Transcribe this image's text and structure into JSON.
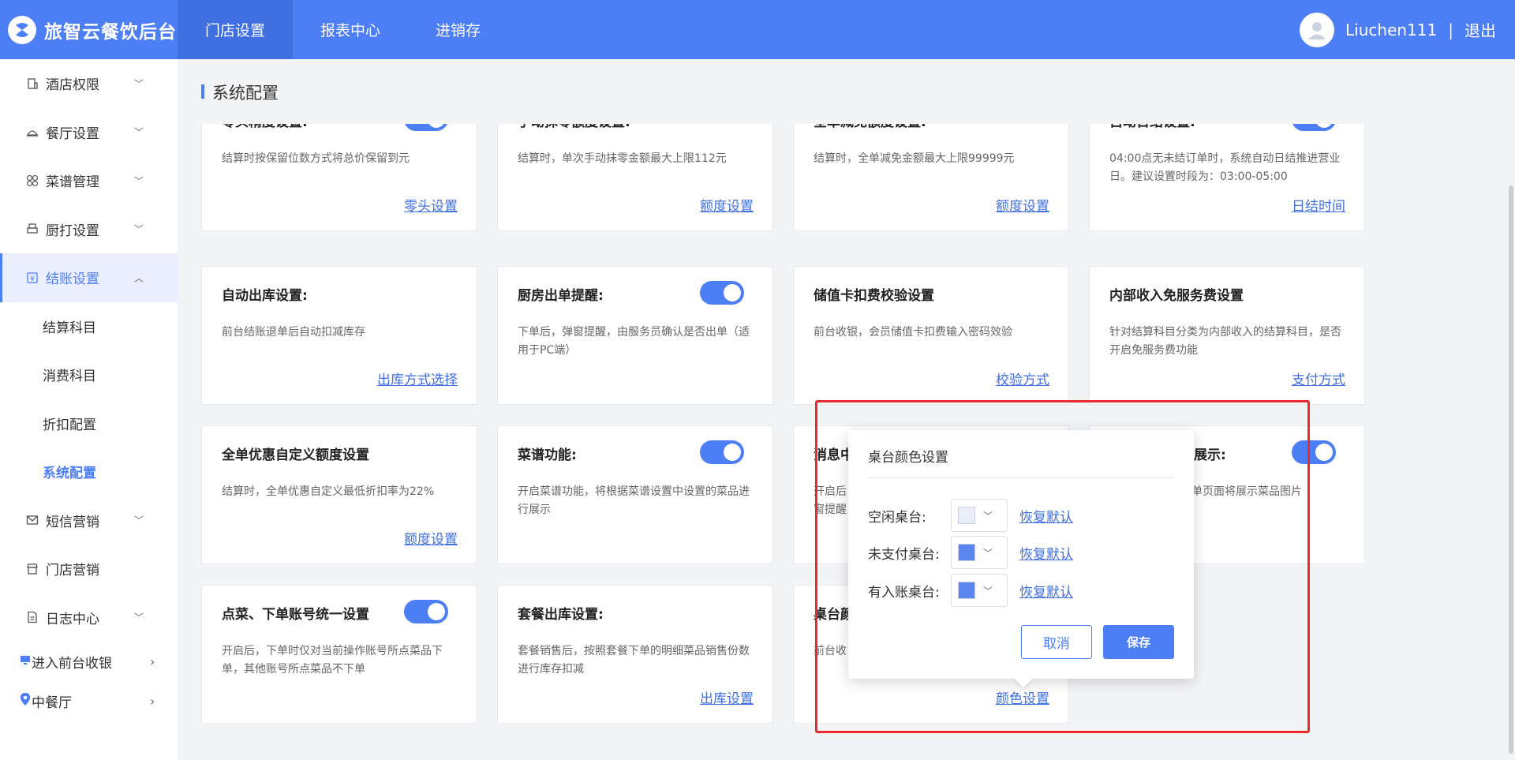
{
  "brand": {
    "title": "旅智云餐饮后台"
  },
  "topnav": [
    "门店设置",
    "报表中心",
    "进销存"
  ],
  "user": {
    "name": "Liuchen111",
    "separator": "|",
    "logout": "退出"
  },
  "sidebar": {
    "items": [
      "酒店权限",
      "餐厅设置",
      "菜谱管理",
      "厨打设置",
      "结账设置"
    ],
    "sub_items": [
      "结算科目",
      "消费科目",
      "折扣配置",
      "系统配置"
    ],
    "more_items": [
      "短信营销",
      "门店营销",
      "日志中心"
    ],
    "bottom": [
      "进入前台收银",
      "中餐厅"
    ]
  },
  "page": {
    "title": "系统配置"
  },
  "cards": [
    {
      "title": "零头精度设置:",
      "desc": "结算时按保留位数方式将总价保留到元",
      "link": "零头设置"
    },
    {
      "title": "手动抹零额度设置:",
      "desc": "结算时，单次手动抹零金额最大上限112元",
      "link": "额度设置"
    },
    {
      "title": "全单减免额度设置:",
      "desc": "结算时，全单减免金额最大上限99999元",
      "link": "额度设置"
    },
    {
      "title": "自动日结设置:",
      "desc": "04:00点无未结订单时，系统自动日结推进营业日。建议设置时段为：03:00-05:00",
      "link": "日结时间"
    },
    {
      "title": "自动出库设置:",
      "desc": "前台结账退单后自动扣减库存",
      "link": "出库方式选择"
    },
    {
      "title": "厨房出单提醒:",
      "desc": "下单后，弹窗提醒，由服务员确认是否出单（适用于PC端）",
      "link": ""
    },
    {
      "title": "储值卡扣费校验设置",
      "desc": "前台收银，会员储值卡扣费输入密码效验",
      "link": "校验方式"
    },
    {
      "title": "内部收入免服务费设置",
      "desc": "针对结算科目分类为内部收入的结算科目，是否开启免服务费功能",
      "link": "支付方式"
    },
    {
      "title": "全单优惠自定义额度设置",
      "desc": "结算时，全单优惠自定义最低折扣率为22%",
      "link": "额度设置"
    },
    {
      "title": "菜谱功能:",
      "desc": "开启菜谱功能，将根据菜谱设置中设置的菜品进行展示",
      "link": ""
    },
    {
      "title": "消息中",
      "desc": "开启后\n窗提醒",
      "link": ""
    },
    {
      "title": "片展示:",
      "desc": "点单页面将展示菜品图片",
      "link": ""
    },
    {
      "title": "点菜、下单账号统一设置",
      "desc": "开启后，下单时仅对当前操作账号所点菜品下单，其他账号所点菜品不下单",
      "link": ""
    },
    {
      "title": "套餐出库设置:",
      "desc": "套餐销售后，按照套餐下单的明细菜品销售份数进行库存扣减",
      "link": "出库设置"
    },
    {
      "title": "桌台颜",
      "desc": "前台收",
      "link": "颜色设置"
    }
  ],
  "popover": {
    "title": "桌台颜色设置",
    "rows": [
      {
        "label": "空闲桌台:",
        "color": "#e9eef8",
        "reset": "恢复默认"
      },
      {
        "label": "未支付桌台:",
        "color": "#5b86f0",
        "reset": "恢复默认"
      },
      {
        "label": "有入账桌台:",
        "color": "#5b86f0",
        "reset": "恢复默认"
      }
    ],
    "cancel": "取消",
    "save": "保存"
  },
  "colors": {
    "primary": "#4c7ef5",
    "highlight": "#ea2b2b"
  }
}
